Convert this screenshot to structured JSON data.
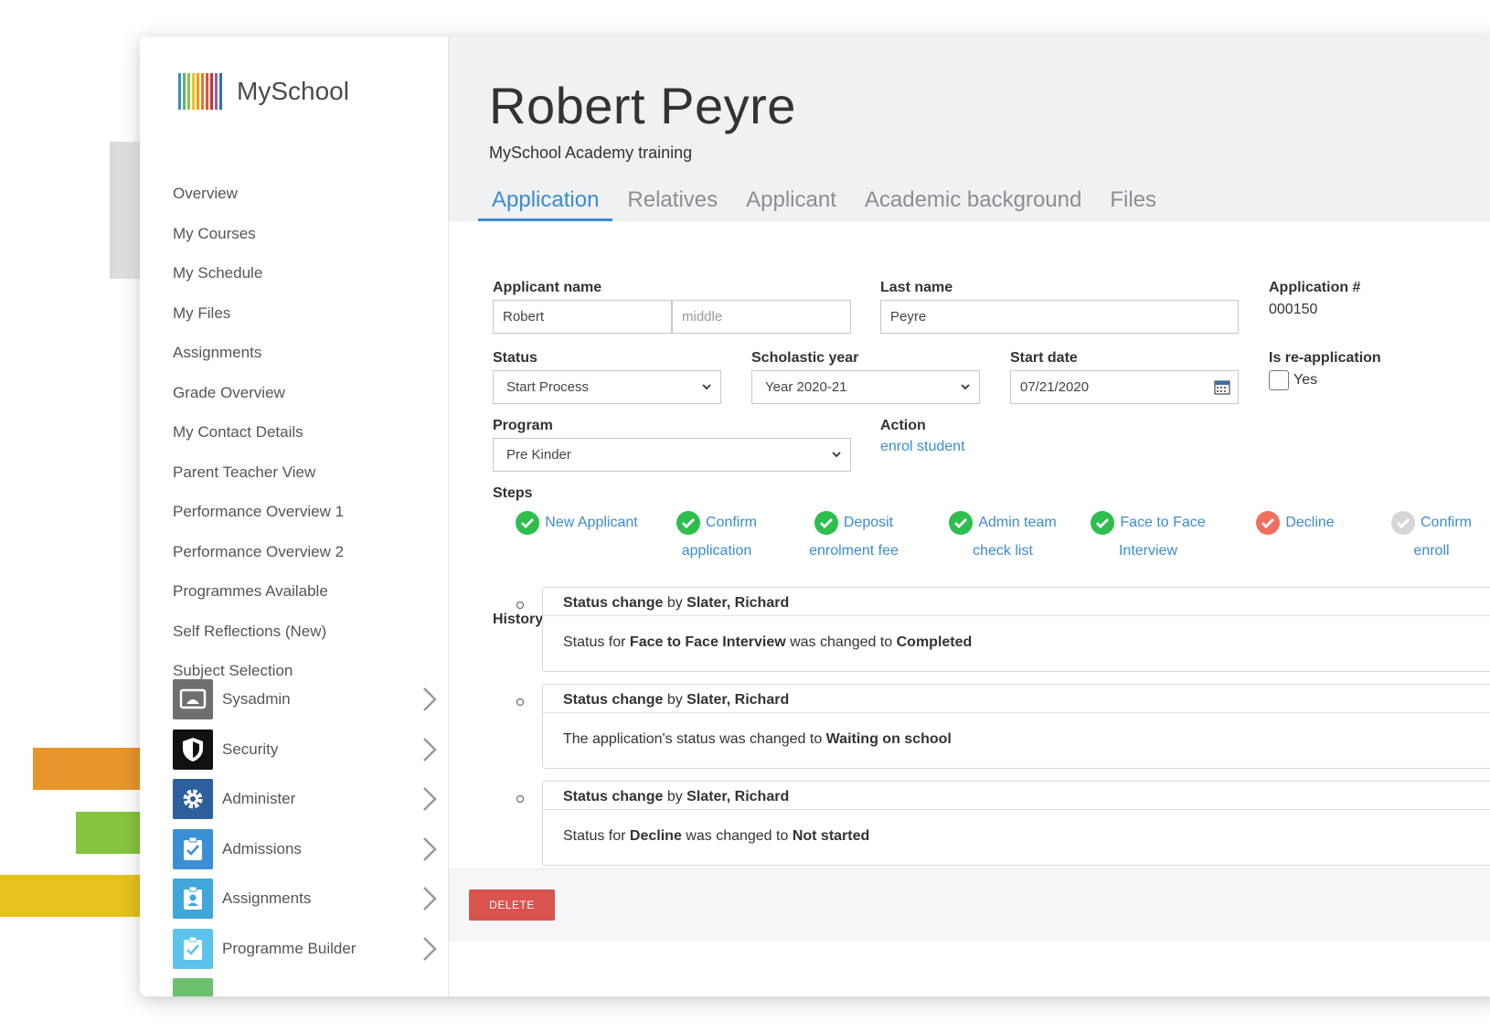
{
  "app": {
    "logo_text": "MySchool"
  },
  "sidebar": {
    "items": [
      {
        "label": "Overview"
      },
      {
        "label": "My Courses"
      },
      {
        "label": "My Schedule"
      },
      {
        "label": "My Files"
      },
      {
        "label": "Assignments"
      },
      {
        "label": "Grade Overview"
      },
      {
        "label": "My Contact Details"
      },
      {
        "label": "Parent Teacher View"
      },
      {
        "label": "Performance Overview 1"
      },
      {
        "label": "Performance Overview 2"
      },
      {
        "label": "Programmes Available"
      },
      {
        "label": "Self Reflections (New)"
      },
      {
        "label": "Subject Selection"
      }
    ],
    "modules": [
      {
        "label": "Sysadmin",
        "icon": "monitor-icon",
        "color": "#6f6f6f"
      },
      {
        "label": "Security",
        "icon": "shield-icon",
        "color": "#111111"
      },
      {
        "label": "Administer",
        "icon": "gear-icon",
        "color": "#2d5f9c"
      },
      {
        "label": "Admissions",
        "icon": "clipboard-check-icon",
        "color": "#3a8fd6"
      },
      {
        "label": "Assignments",
        "icon": "badge-icon",
        "color": "#41a6d9"
      },
      {
        "label": "Programme Builder",
        "icon": "clipboard-check-icon",
        "color": "#5cc3ea"
      }
    ]
  },
  "header": {
    "title": "Robert Peyre",
    "subtitle": "MySchool Academy training",
    "tabs": [
      {
        "label": "Application",
        "active": true
      },
      {
        "label": "Relatives"
      },
      {
        "label": "Applicant"
      },
      {
        "label": "Academic background"
      },
      {
        "label": "Files"
      }
    ]
  },
  "form": {
    "applicant_name": {
      "label": "Applicant name",
      "first": "Robert",
      "middle_placeholder": "middle"
    },
    "last_name": {
      "label": "Last name",
      "value": "Peyre"
    },
    "application_no": {
      "label": "Application #",
      "value": "000150"
    },
    "status": {
      "label": "Status",
      "value": "Start Process"
    },
    "scholastic_year": {
      "label": "Scholastic year",
      "value": "Year 2020-21"
    },
    "start_date": {
      "label": "Start date",
      "value": "07/21/2020"
    },
    "reapplication": {
      "label": "Is re-application",
      "option": "Yes",
      "checked": false
    },
    "program": {
      "label": "Program",
      "value": "Pre Kinder"
    },
    "action": {
      "label": "Action",
      "link": "enrol student"
    },
    "steps_label": "Steps"
  },
  "steps": [
    {
      "line1": "New Applicant",
      "line2": "",
      "state": "done"
    },
    {
      "line1": "Confirm",
      "line2": "application",
      "state": "done"
    },
    {
      "line1": "Deposit",
      "line2": "enrolment fee",
      "state": "done"
    },
    {
      "line1": "Admin team",
      "line2": "check list",
      "state": "done"
    },
    {
      "line1": "Face to Face",
      "line2": "Interview",
      "state": "done"
    },
    {
      "line1": "Decline",
      "line2": "",
      "state": "declined"
    },
    {
      "line1": "Confirm",
      "line2": "enroll",
      "state": "pending"
    }
  ],
  "colors": {
    "done": "#2dbe4e",
    "declined": "#f07060",
    "pending": "#d6d6d6",
    "accent": "#3b8bd0",
    "danger": "#d9534f"
  },
  "history": {
    "label": "History",
    "items": [
      {
        "prefix": "Status change",
        "by": "by",
        "author": "Slater, Richard",
        "body": [
          {
            "t": "Status for "
          },
          {
            "t": "Face to Face Interview",
            "b": true
          },
          {
            "t": " was changed to "
          },
          {
            "t": "Completed",
            "b": true
          }
        ]
      },
      {
        "prefix": "Status change",
        "by": "by",
        "author": "Slater, Richard",
        "body": [
          {
            "t": "The application's status was changed to "
          },
          {
            "t": "Waiting on school",
            "b": true
          }
        ]
      },
      {
        "prefix": "Status change",
        "by": "by",
        "author": "Slater, Richard",
        "body": [
          {
            "t": "Status for "
          },
          {
            "t": "Decline",
            "b": true
          },
          {
            "t": " was changed to "
          },
          {
            "t": "Not started",
            "b": true
          }
        ]
      }
    ]
  },
  "footer": {
    "delete_label": "DELETE"
  }
}
